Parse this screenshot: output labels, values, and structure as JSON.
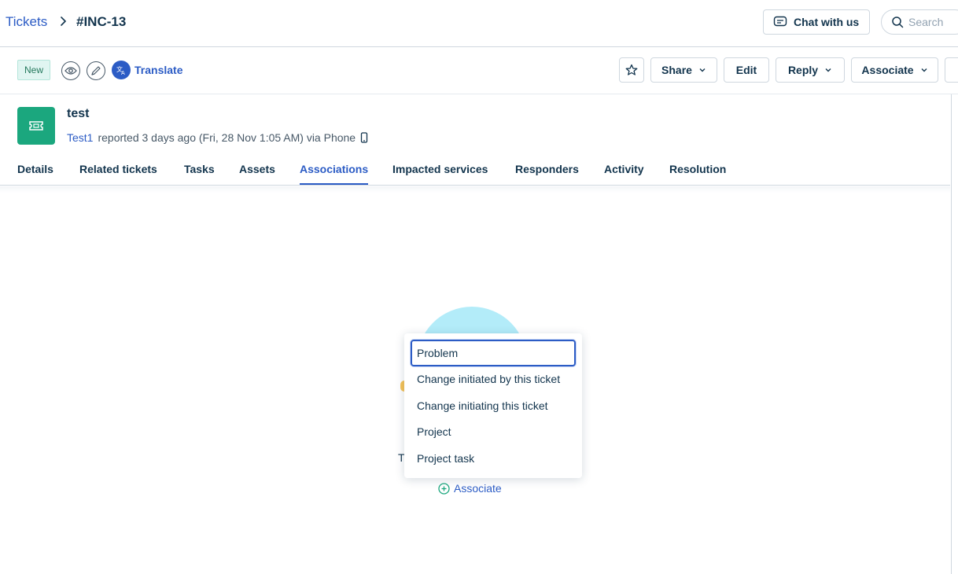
{
  "breadcrumb": {
    "parent": "Tickets",
    "current": "#INC-13"
  },
  "header": {
    "chat_label": "Chat with us",
    "search_placeholder": "Search"
  },
  "actions": {
    "status": "New",
    "translate": "Translate",
    "share": "Share",
    "edit": "Edit",
    "reply": "Reply",
    "associate": "Associate"
  },
  "ticket": {
    "title": "test",
    "requester": "Test1",
    "meta": "reported 3 days ago (Fri, 28 Nov 1:05 AM) via Phone"
  },
  "tabs": [
    {
      "label": "Details"
    },
    {
      "label": "Related tickets"
    },
    {
      "label": "Tasks"
    },
    {
      "label": "Assets"
    },
    {
      "label": "Associations"
    },
    {
      "label": "Impacted services"
    },
    {
      "label": "Responders"
    },
    {
      "label": "Activity"
    },
    {
      "label": "Resolution"
    }
  ],
  "active_tab": "Associations",
  "empty_state": {
    "text_visible": "T",
    "associate_link": "Associate"
  },
  "dropdown": {
    "items": [
      {
        "label": "Problem"
      },
      {
        "label": "Change initiated by this ticket"
      },
      {
        "label": "Change initiating this ticket"
      },
      {
        "label": "Project"
      },
      {
        "label": "Project task"
      }
    ],
    "focused": "Problem"
  },
  "colors": {
    "accent": "#2c5cc5",
    "ticket_icon_bg": "#1ba77e",
    "status_bg": "#e0f5f1"
  }
}
